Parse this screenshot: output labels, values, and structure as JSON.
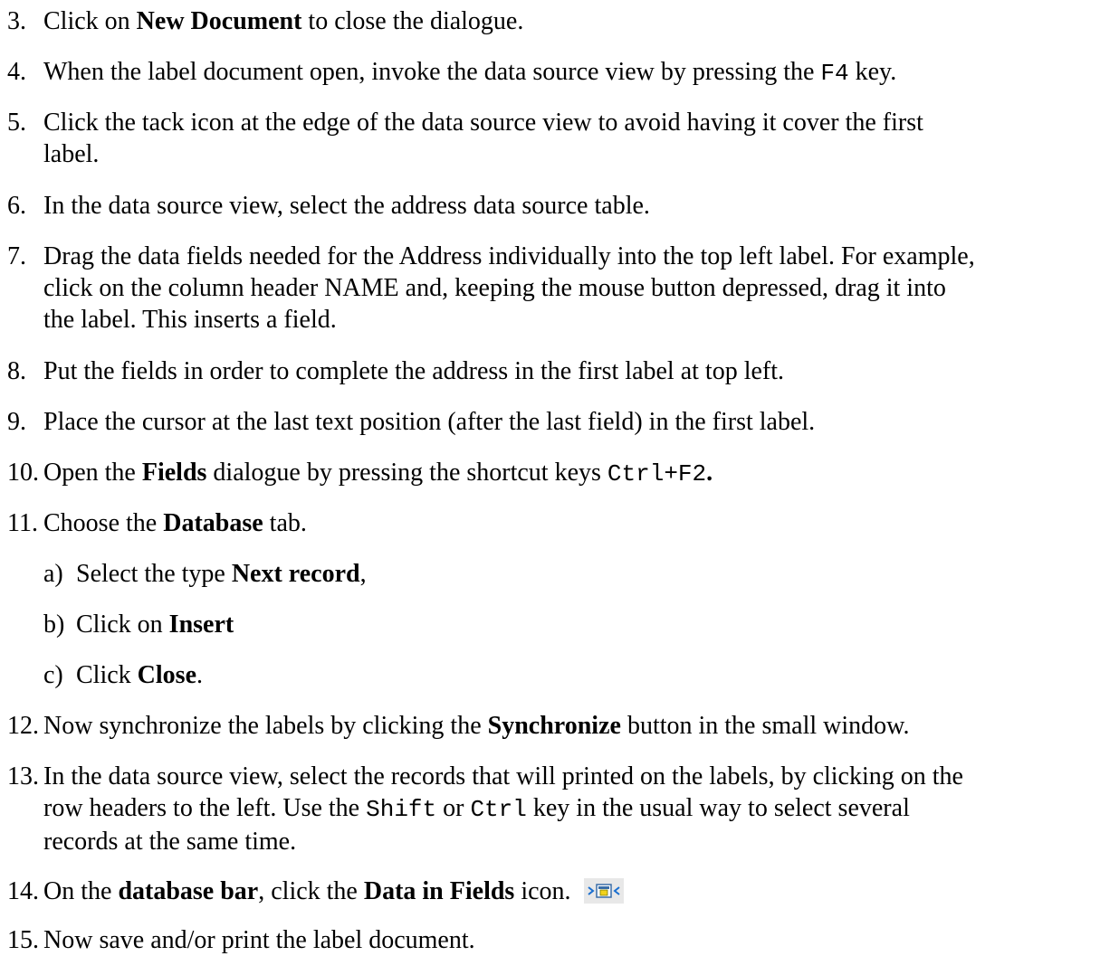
{
  "steps": [
    {
      "num": "3.",
      "a": "Click on ",
      "b": "New Document",
      "c": " to close the dialogue."
    },
    {
      "num": "4.",
      "a": "When the label document open, invoke the data source view by pressing the ",
      "code": "F4",
      "b": " key."
    },
    {
      "num": "5.",
      "line1": "Click the tack icon at the edge of the data source view to avoid having it cover the first",
      "line2": "label."
    },
    {
      "num": "6.",
      "text": "In the data source view, select the address data source table."
    },
    {
      "num": "7.",
      "line1": "Drag the data fields needed for the Address individually into the top left label. For example,",
      "line2": "click on the column header NAME and, keeping the mouse button depressed, drag it into",
      "line3": "the label. This inserts a field."
    },
    {
      "num": "8.",
      "text": "Put the fields in order to complete the address in the first label at top left."
    },
    {
      "num": "9.",
      "text": "Place the cursor at the last text position (after the last field) in the first label."
    },
    {
      "num": "10.",
      "a": "Open the ",
      "b": "Fields",
      "c": " dialogue by pressing the shortcut keys ",
      "code": "Ctrl+F2",
      "d": "."
    },
    {
      "num": "11.",
      "a": "Choose the ",
      "b": "Database",
      "c": " tab."
    },
    {
      "num": "12.",
      "a": "Now synchronize the labels by clicking the ",
      "b": "Synchronize",
      "c": " button in the small window."
    },
    {
      "num": "13.",
      "line1": "In the data source view, select the records that will printed on the labels, by clicking on the",
      "line2a": "row headers to the left. Use the ",
      "code1": "Shift",
      "line2b": " or ",
      "code2": "Ctrl",
      "line2c": " key in the usual way to select several",
      "line3": "records at the same time."
    },
    {
      "num": "14.",
      "a": "On the ",
      "b": "database bar",
      "c": ", click the ",
      "d": "Data in Fields",
      "e": " icon.",
      "icon": "data-in-fields-icon"
    },
    {
      "num": "15.",
      "text": "Now save and/or print the label document."
    }
  ],
  "substeps": [
    {
      "num": "a)",
      "a": "Select the type ",
      "b": "Next record",
      "c": ","
    },
    {
      "num": "b)",
      "a": "Click on ",
      "b": "Insert"
    },
    {
      "num": "c)",
      "a": "Click ",
      "b": "Close",
      "c": "."
    }
  ]
}
